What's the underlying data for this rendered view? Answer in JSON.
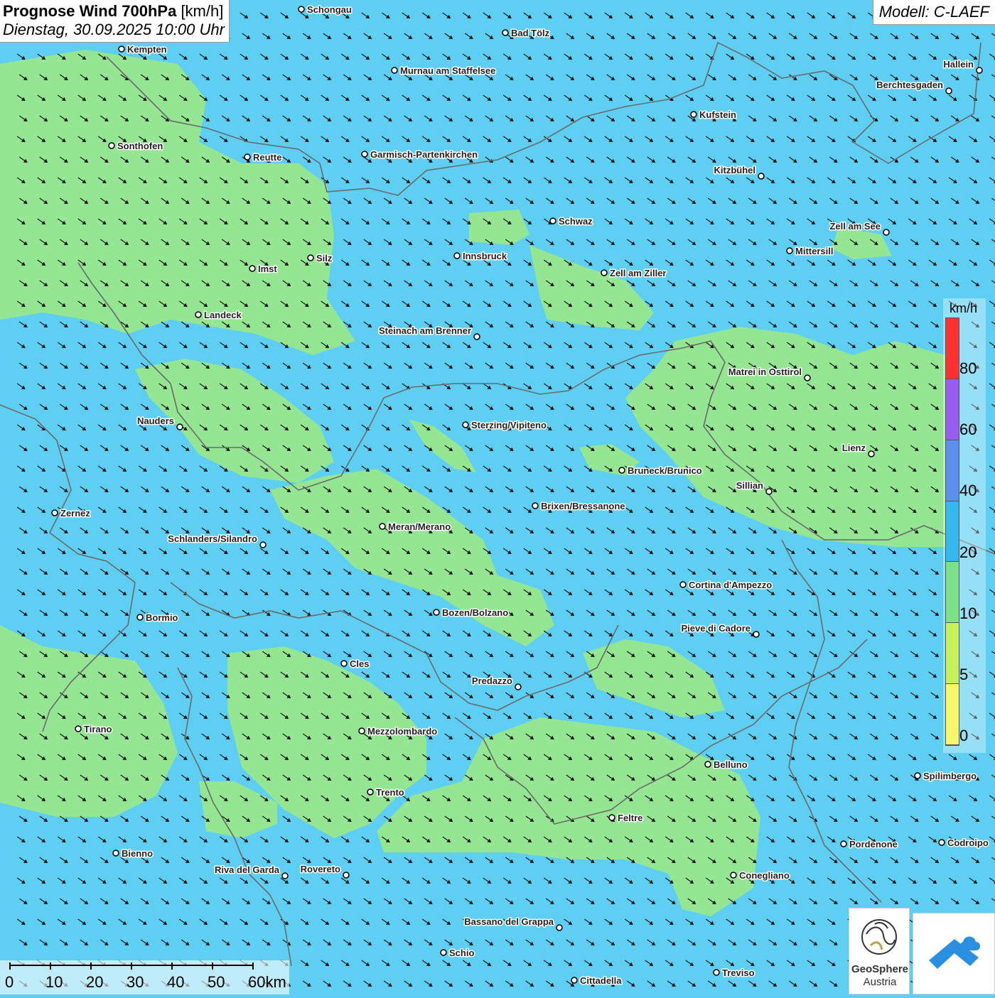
{
  "title": {
    "main": "Prognose Wind 700hPa",
    "unit": "[km/h]",
    "datetime": "Dienstag, 30.09.2025 10:00 Uhr"
  },
  "model": "Modell: C-LAEF",
  "legend": {
    "unit": "km/h",
    "ticks": [
      "80",
      "60",
      "40",
      "20",
      "10",
      "5",
      "0"
    ],
    "colors": [
      "#ff3030",
      "#9a5cf0",
      "#5b8ff0",
      "#34b8ee",
      "#7de08a",
      "#c7f05a",
      "#f8f66a"
    ]
  },
  "scale": {
    "labels": [
      "0",
      "10",
      "20",
      "30",
      "40",
      "50",
      "60km"
    ]
  },
  "logos": {
    "geosphere_line1": "GeoSphere",
    "geosphere_line2": "Austria"
  },
  "colors": {
    "calm_green": "#94e692",
    "moderate_blue": "#5ecff3",
    "border": "#6a6a6a",
    "arrow": "#111111"
  },
  "cities": [
    {
      "name": "Schongau"
    },
    {
      "name": "Bad Tölz"
    },
    {
      "name": "Kempten"
    },
    {
      "name": "Murnau am Staffelsee"
    },
    {
      "name": "Hallein"
    },
    {
      "name": "Berchtesgaden"
    },
    {
      "name": "Kufstein"
    },
    {
      "name": "Sonthofen"
    },
    {
      "name": "Reutte"
    },
    {
      "name": "Garmisch-Partenkirchen"
    },
    {
      "name": "Kitzbühel"
    },
    {
      "name": "Schwaz"
    },
    {
      "name": "Zell am See"
    },
    {
      "name": "Mittersill"
    },
    {
      "name": "Innsbruck"
    },
    {
      "name": "Silz"
    },
    {
      "name": "Imst"
    },
    {
      "name": "Zell am Ziller"
    },
    {
      "name": "Landeck"
    },
    {
      "name": "Steinach am Brenner"
    },
    {
      "name": "Matrei in Osttirol"
    },
    {
      "name": "Nauders"
    },
    {
      "name": "Sterzing/Vipiteno"
    },
    {
      "name": "Lienz"
    },
    {
      "name": "Bruneck/Brunico"
    },
    {
      "name": "Sillian"
    },
    {
      "name": "Brixen/Bressanone"
    },
    {
      "name": "Zernez"
    },
    {
      "name": "Meran/Merano"
    },
    {
      "name": "Schlanders/Silandro"
    },
    {
      "name": "Cortina d'Ampezzo"
    },
    {
      "name": "Bozen/Bolzano"
    },
    {
      "name": "Bormio"
    },
    {
      "name": "Pieve di Cadore"
    },
    {
      "name": "Cles"
    },
    {
      "name": "Predazzo"
    },
    {
      "name": "Tirano"
    },
    {
      "name": "Mezzolombardo"
    },
    {
      "name": "Belluno"
    },
    {
      "name": "Spilimbergo"
    },
    {
      "name": "Trento"
    },
    {
      "name": "Feltre"
    },
    {
      "name": "Pordenone"
    },
    {
      "name": "Codroipo"
    },
    {
      "name": "Bienno"
    },
    {
      "name": "Riva del Garda"
    },
    {
      "name": "Rovereto"
    },
    {
      "name": "Conegliano"
    },
    {
      "name": "Bassano del Grappa"
    },
    {
      "name": "Schio"
    },
    {
      "name": "Treviso"
    },
    {
      "name": "Cittadella"
    }
  ]
}
